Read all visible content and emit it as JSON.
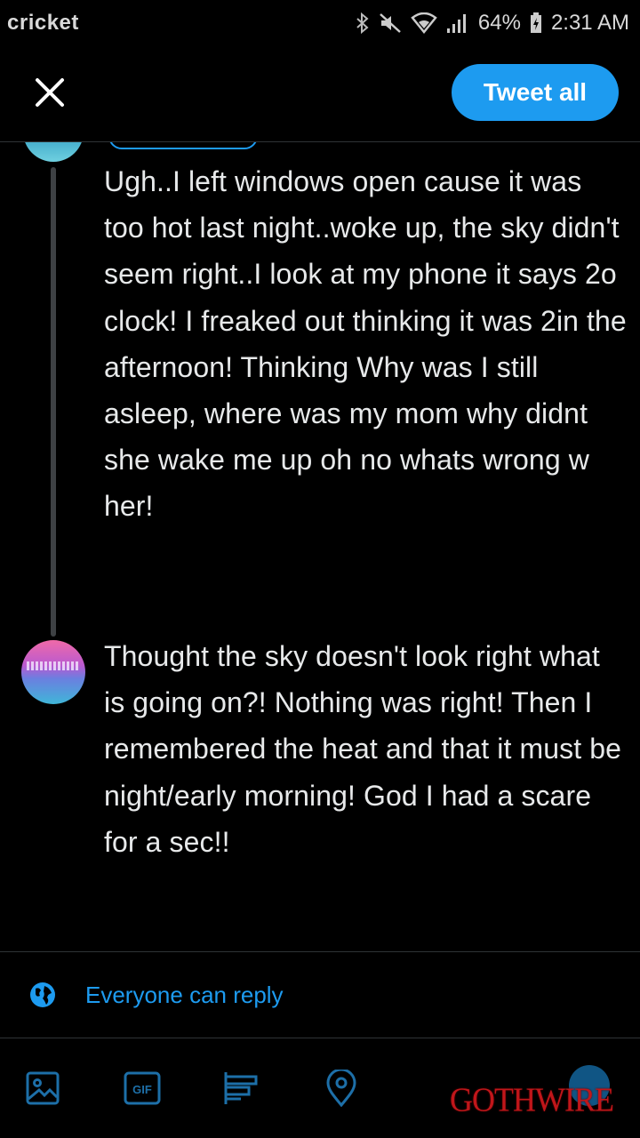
{
  "status_bar": {
    "carrier": "cricket",
    "battery": "64%",
    "time": "2:31 AM",
    "icons": [
      "bluetooth-icon",
      "mute-icon",
      "wifi-icon",
      "signal-icon",
      "battery-charging-icon"
    ]
  },
  "header": {
    "close_icon": "close-icon",
    "tweet_all_label": "Tweet all"
  },
  "thread": {
    "tweets": [
      {
        "text": "Ugh..I left windows open cause it was too hot last night..woke up, the sky didn't seem right..I look at my phone it says 2o clock! I freaked out thinking it was 2in the afternoon! Thinking Why was I still asleep, where was my mom why didnt she wake me up oh no whats wrong w her!"
      },
      {
        "text": "Thought the sky doesn't look right what is going on?! Nothing was right! Then I remembered the heat and that it must be night/early morning! God I had a scare for a sec!!"
      }
    ]
  },
  "reply_setting": {
    "icon": "globe-icon",
    "label": "Everyone can reply"
  },
  "toolbar": {
    "items": [
      "image-icon",
      "gif-icon",
      "poll-icon",
      "location-icon",
      "add-tweet-icon"
    ]
  },
  "watermark": "GOTHWIRE",
  "colors": {
    "accent": "#1d9bf0",
    "background": "#000000",
    "text": "#e7e9ea",
    "watermark": "#c0161a"
  }
}
